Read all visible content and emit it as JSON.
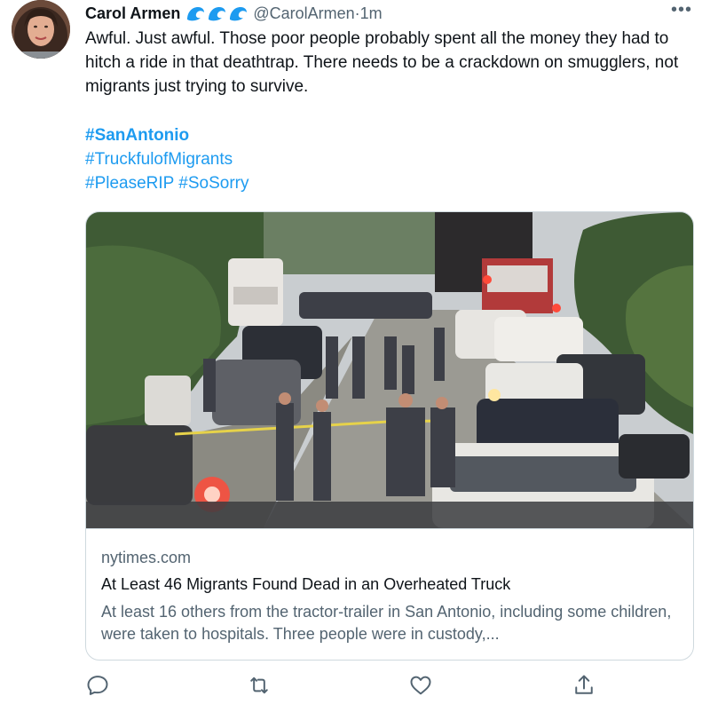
{
  "tweet": {
    "display_name": "Carol Armen",
    "badges": [
      "wave-icon",
      "wave-icon",
      "wave-icon"
    ],
    "handle": "@CarolArmen",
    "separator": " · ",
    "time": "1m",
    "more_icon": "more-dots-icon",
    "text": "Awful. Just awful. Those poor people probably spent all the money they had to hitch a ride in that deathtrap. There needs to be a crackdown on smugglers, not migrants just trying to survive.",
    "hashtags": {
      "line1": [
        "#SanAntonio"
      ],
      "line2": [
        "#TruckfulofMigrants"
      ],
      "line3": [
        "#PleaseRIP",
        "#SoSorry"
      ]
    }
  },
  "card": {
    "domain": "nytimes.com",
    "title": "At Least 46 Migrants Found Dead in an Overheated Truck",
    "description": "At least 16 others from the tractor-trailer in San Antonio, including some children, were taken to hospitals. Three people were in custody,..."
  },
  "actions": [
    {
      "name": "reply",
      "icon": "reply-icon"
    },
    {
      "name": "retweet",
      "icon": "retweet-icon"
    },
    {
      "name": "like",
      "icon": "like-icon"
    },
    {
      "name": "share",
      "icon": "share-icon"
    }
  ],
  "colors": {
    "accent": "#1d9bf0",
    "secondary_text": "#536471",
    "primary_text": "#0f1419",
    "border": "#cfd9de"
  }
}
